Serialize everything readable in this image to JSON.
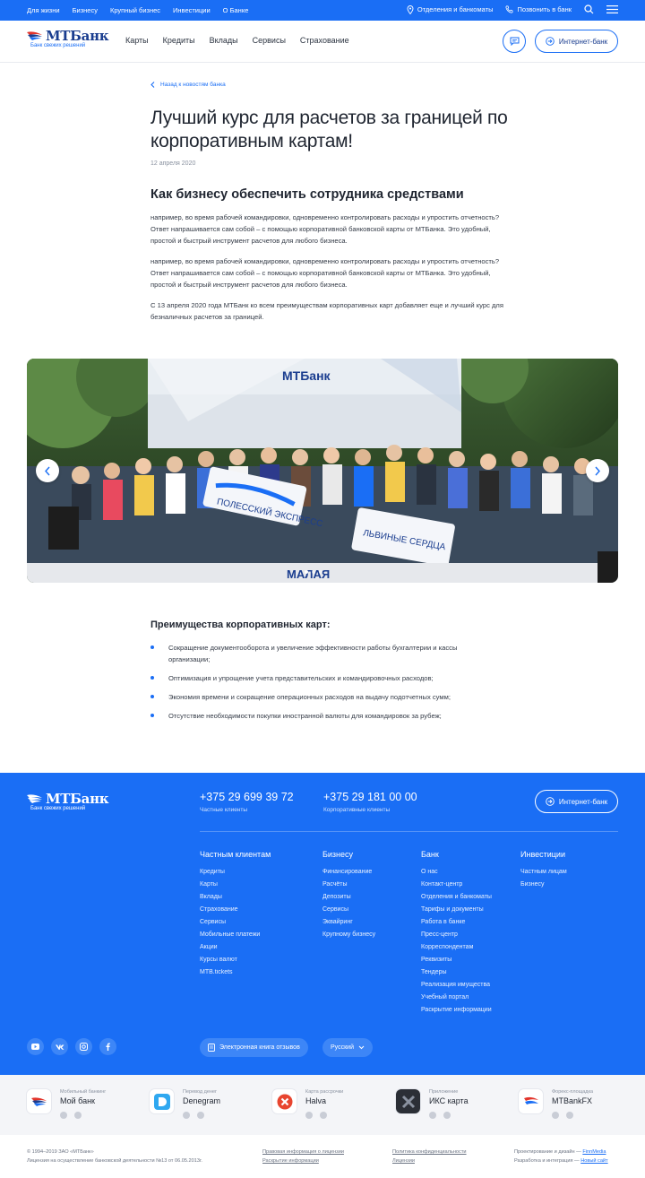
{
  "topbar": {
    "links": [
      "Для жизни",
      "Бизнесу",
      "Крупный бизнес",
      "Инвестиции",
      "О Банке"
    ],
    "branches": "Отделения и банкоматы",
    "call": "Позвонить в банк"
  },
  "header": {
    "logo_text": "МТБанк",
    "logo_sub": "Банк свежих решений",
    "nav": [
      "Карты",
      "Кредиты",
      "Вклады",
      "Сервисы",
      "Страхование"
    ],
    "internet_bank": "Интернет-банк"
  },
  "article": {
    "back": "Назад к новостям банка",
    "title": "Лучший курс для расчетов за границей по корпоративным картам!",
    "date": "12 апреля 2020",
    "subtitle": "Как бизнесу обеспечить сотрудника средствами",
    "paragraphs": [
      "например, во время рабочей командировки, одновременно контролировать расходы и упростить отчетность? Ответ напрашивается сам собой – с помощью корпоративной банковской карты от МТБанка. Это удобный, простой и быстрый инструмент расчетов для любого бизнеса.",
      "например, во время рабочей командировки, одновременно контролировать расходы и упростить отчетность? Ответ напрашивается сам собой – с помощью корпоративной банковской карты от МТБанка. Это удобный, простой и быстрый инструмент расчетов для любого бизнеса.",
      "С 13 апреля 2020 года МТБанк ко всем преимуществам корпоративных карт добавляет еще и лучший курс для  безналичных расчетов за границей."
    ],
    "photo_banner_text": "МТБанк",
    "photo_stage_text": "МАЛАЯ",
    "photo_flag_text": "ПОЛЕССКИЙ ЭКСПРЕСС",
    "photo_flag2_text": "ЛЬВИНЫЕ СЕРДЦА"
  },
  "advantages": {
    "title": "Преимущества корпоративных карт:",
    "items": [
      "Сокращение документооборота и увеличение эффективности работы бухгалтерии и кассы организации;",
      "Оптимизация и упрощение учета представительских и командировочных расходов;",
      "Экономия времени и сокращение операционных расходов на выдачу подотчетных сумм;",
      "Отсутствие необходимости покупки иностранной валюты для командировок за рубеж;"
    ]
  },
  "footer": {
    "logo_text": "МТБанк",
    "logo_sub": "Банк свежих решений",
    "phone1": "+375 29 699 39 72",
    "phone1_caption": "Частные клиенты",
    "phone2": "+375 29 181 00 00",
    "phone2_caption": "Корпоративные клиенты",
    "internet_bank": "Интернет-банк",
    "columns": [
      {
        "title": "Частным клиентам",
        "links": [
          "Кредиты",
          "Карты",
          "Вклады",
          "Страхование",
          "Сервисы",
          "Мобильные платежи",
          "Акции",
          "Курсы валют",
          "MTB.tickets"
        ]
      },
      {
        "title": "Бизнесу",
        "links": [
          "Финансирование",
          "Расчёты",
          "Депозиты",
          "Сервисы",
          "Эквайринг",
          "Крупному бизнесу"
        ]
      },
      {
        "title": "Банк",
        "links": [
          "О нас",
          "Контакт-центр",
          "Отделения и банкоматы",
          "Тарифы и документы",
          "Работа в банке",
          "Пресс-центр",
          "Корреспондентам",
          "Реквизиты",
          "Тендеры",
          "Реализация имущества",
          "Учебный портал",
          "Раскрытие информации"
        ]
      },
      {
        "title": "Инвестиции",
        "links": [
          "Частным лицам",
          "Бизнесу"
        ]
      }
    ],
    "feedback": "Электронная книга отзывов",
    "language": "Русский"
  },
  "apps": [
    {
      "sub": "Мобильный банкинг",
      "name": "Мой банк"
    },
    {
      "sub": "Перевод денег",
      "name": "Denegram"
    },
    {
      "sub": "Карта рассрочки",
      "name": "Halva"
    },
    {
      "sub": "Приложение",
      "name": "ИКС карта"
    },
    {
      "sub": "Форекс-площадка",
      "name": "MTBankFX"
    }
  ],
  "legal": {
    "copyright": "© 1994–2019 ЗАО «МТБанк»",
    "license": "Лицензия на осуществление банковской деятельности №13 от 06.05.2013г.",
    "legal_info": "Правовая информация о лицензии",
    "disclosure": "Раскрытие информации",
    "privacy": "Политика конфиденциальности",
    "licenses": "Лицензии",
    "design_label": "Проектирование и дизайн —",
    "design_by": "FinnMedia",
    "dev_label": "Разработка и интеграция —",
    "dev_by": "Новый сайт"
  },
  "colors": {
    "brand": "#1a6ef5",
    "dark_brand": "#1a3d8f",
    "accent": "#e2342b"
  }
}
